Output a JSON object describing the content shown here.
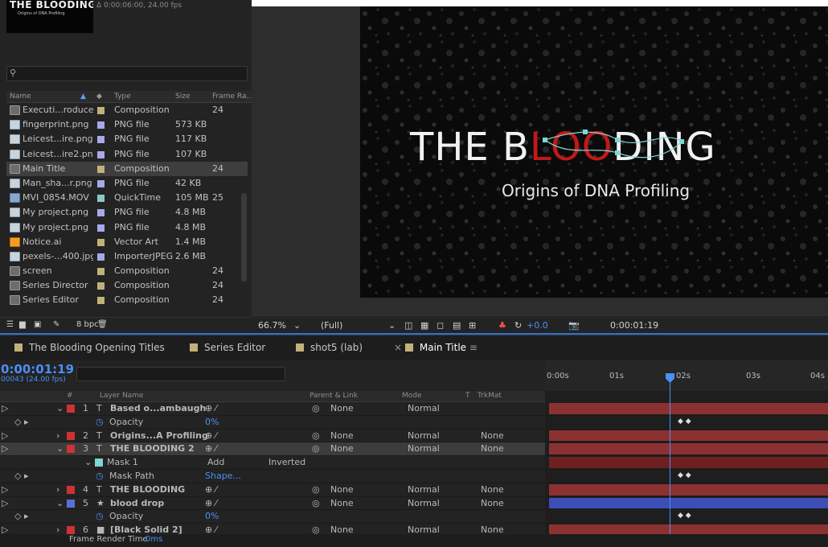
{
  "project": {
    "thumb_title": "THE BLOODING",
    "thumb_subtitle": "Origins of DNA Profiling",
    "thumb_info": "Δ 0:00:06:00, 24.00 fps",
    "columns": {
      "name": "Name",
      "type": "Type",
      "size": "Size",
      "frame_rate": "Frame Ra..."
    },
    "items": [
      {
        "name": "Executi...roducer",
        "kind": "comp",
        "label_color": "#c2b27a",
        "type": "Composition",
        "size": "",
        "fr": "24"
      },
      {
        "name": "fingerprint.png",
        "kind": "png",
        "label_color": "#a8a8e8",
        "type": "PNG file",
        "size": "573 KB",
        "fr": ""
      },
      {
        "name": "Leicest...ire.png",
        "kind": "png",
        "label_color": "#a8a8e8",
        "type": "PNG file",
        "size": "117 KB",
        "fr": ""
      },
      {
        "name": "Leicest...ire2.png",
        "kind": "png",
        "label_color": "#a8a8e8",
        "type": "PNG file",
        "size": "107 KB",
        "fr": ""
      },
      {
        "name": "Main Title",
        "kind": "comp",
        "label_color": "#c2b27a",
        "type": "Composition",
        "size": "",
        "fr": "24",
        "selected": true
      },
      {
        "name": "Man_sha...r.png",
        "kind": "png",
        "label_color": "#a8a8e8",
        "type": "PNG file",
        "size": "42 KB",
        "fr": ""
      },
      {
        "name": "MVI_0854.MOV",
        "kind": "mov",
        "label_color": "#8ec7c7",
        "type": "QuickTime",
        "size": "105 MB",
        "fr": "25"
      },
      {
        "name": "My project.png",
        "kind": "png",
        "label_color": "#a8a8e8",
        "type": "PNG file",
        "size": "4.8 MB",
        "fr": ""
      },
      {
        "name": "My project.png",
        "kind": "png",
        "label_color": "#a8a8e8",
        "type": "PNG file",
        "size": "4.8 MB",
        "fr": ""
      },
      {
        "name": "Notice.ai",
        "kind": "ai",
        "label_color": "#c2b27a",
        "type": "Vector Art",
        "size": "1.4 MB",
        "fr": ""
      },
      {
        "name": "pexels-...400.jpg",
        "kind": "png",
        "label_color": "#a8a8e8",
        "type": "ImporterJPEG",
        "size": "2.6 MB",
        "fr": ""
      },
      {
        "name": "screen",
        "kind": "comp",
        "label_color": "#c2b27a",
        "type": "Composition",
        "size": "",
        "fr": "24"
      },
      {
        "name": "Series Director",
        "kind": "comp",
        "label_color": "#c2b27a",
        "type": "Composition",
        "size": "",
        "fr": "24"
      },
      {
        "name": "Series Editor",
        "kind": "comp",
        "label_color": "#c2b27a",
        "type": "Composition",
        "size": "",
        "fr": "24"
      }
    ],
    "bpc": "8 bpc"
  },
  "viewer": {
    "title_pre": "THE B",
    "title_red": "LOO",
    "title_post": "DING",
    "subtitle": "Origins of DNA Profiling",
    "zoom": "66.7%",
    "resolution": "(Full)",
    "exposure": "+0.0",
    "timecode": "0:00:01:19"
  },
  "tabs": [
    {
      "label": "The Blooding Opening Titles",
      "active": false
    },
    {
      "label": "Series Editor",
      "active": false
    },
    {
      "label": "shot5 (lab)",
      "active": false
    },
    {
      "label": "Main Title",
      "active": true
    }
  ],
  "timeline": {
    "timecode": "0:00:01:19",
    "frames": "00043 (24.00 fps)",
    "columns": {
      "num": "#",
      "layer_name": "Layer Name",
      "parent": "Parent & Link",
      "mode": "Mode",
      "t": "T",
      "trkmat": "TrkMat"
    },
    "ruler": [
      "0:00s",
      "01s",
      "02s",
      "03s",
      "04s"
    ],
    "layers": [
      {
        "num": "1",
        "type": "T",
        "name": "Based o...ambaugh",
        "color": "#c33",
        "parent": "None",
        "mode": "Normal",
        "trkmat": "",
        "expanded": true
      },
      {
        "prop": "Opacity",
        "value": "0%"
      },
      {
        "num": "2",
        "type": "T",
        "name": "Origins...A Profiling",
        "color": "#c33",
        "parent": "None",
        "mode": "Normal",
        "trkmat": "None"
      },
      {
        "num": "3",
        "type": "T",
        "name": "THE BLOODING 2",
        "color": "#c33",
        "parent": "None",
        "mode": "Normal",
        "trkmat": "None",
        "expanded": true,
        "selected": true
      },
      {
        "mask": "Mask 1",
        "mode": "Add",
        "inverted": "Inverted"
      },
      {
        "prop": "Mask Path",
        "value": "Shape..."
      },
      {
        "num": "4",
        "type": "T",
        "name": "THE BLOODING",
        "color": "#c33",
        "parent": "None",
        "mode": "Normal",
        "trkmat": "None"
      },
      {
        "num": "5",
        "type": "★",
        "name": "blood drop",
        "color": "#5a6fd6",
        "parent": "None",
        "mode": "Normal",
        "trkmat": "None",
        "expanded": true
      },
      {
        "prop": "Opacity",
        "value": "0%"
      },
      {
        "num": "6",
        "type": "■",
        "name": "[Black Solid 2]",
        "color": "#c33",
        "parent": "None",
        "mode": "Normal",
        "trkmat": "None"
      }
    ],
    "footer": {
      "label": "Frame Render Time",
      "value": "0ms"
    }
  }
}
